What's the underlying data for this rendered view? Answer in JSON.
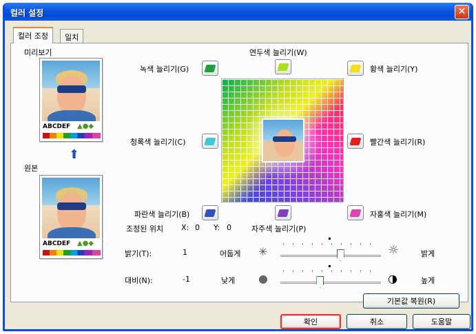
{
  "window": {
    "title": "컬러 설정",
    "close_glyph": "✕"
  },
  "tabs": [
    {
      "label": "컬러 조정",
      "active": true
    },
    {
      "label": "일치",
      "active": false
    }
  ],
  "preview": {
    "label": "미리보기",
    "original_label": "원본",
    "sample_text": "ABCDEF",
    "shapes_glyphs": "▲●◆"
  },
  "color_buttons": {
    "lime": {
      "label": "연두색 늘리기(W)",
      "color": "#a8e020",
      "icon": "lime-chip-icon"
    },
    "green": {
      "label": "녹색 늘리기(G)",
      "color": "#20a040",
      "icon": "green-chip-icon"
    },
    "yellow": {
      "label": "황색 늘리기(Y)",
      "color": "#f0e020",
      "icon": "yellow-chip-icon"
    },
    "cyan": {
      "label": "청록색 늘리기(C)",
      "color": "#40c8d8",
      "icon": "cyan-chip-icon"
    },
    "red": {
      "label": "빨간색 늘리기(R)",
      "color": "#e02020",
      "icon": "red-chip-icon"
    },
    "blue": {
      "label": "파란색 늘리기(B)",
      "color": "#3050c0",
      "icon": "blue-chip-icon"
    },
    "purple": {
      "label": "자주색 늘리기(P)",
      "color": "#8040c0",
      "icon": "purple-chip-icon"
    },
    "magenta": {
      "label": "자홍색 늘리기(M)",
      "color": "#e040b0",
      "icon": "magenta-chip-icon"
    }
  },
  "position": {
    "label": "조정된 위치",
    "x_label": "X:",
    "x_value": "0",
    "y_label": "Y:",
    "y_value": "0"
  },
  "brightness": {
    "label": "밝기(T):",
    "value": "1",
    "low_label": "어둡게",
    "high_label": "밝게",
    "level_fraction": 0.6
  },
  "contrast": {
    "label": "대비(N):",
    "value": "-1",
    "low_label": "낮게",
    "high_label": "높게",
    "level_fraction": 0.4
  },
  "buttons": {
    "reset": "기본값 복원(R)",
    "ok": "확인",
    "cancel": "취소",
    "help": "도움말"
  },
  "colors": {
    "title_bar": "#0856e0",
    "dialog_bg": "#ece9d8",
    "active_tab_accent": "#e68b2c"
  }
}
